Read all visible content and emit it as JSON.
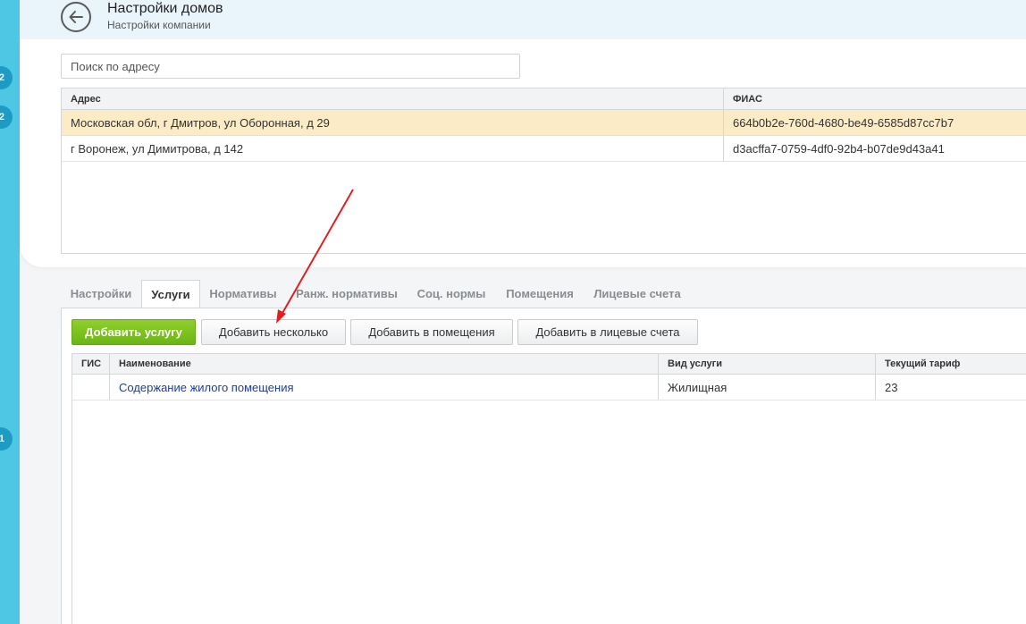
{
  "header": {
    "title": "Настройки домов",
    "subtitle": "Настройки компании"
  },
  "sidebar_badges": [
    "2",
    "2",
    "1"
  ],
  "search": {
    "placeholder": "Поиск по адресу",
    "value": ""
  },
  "houses": {
    "columns": [
      "Адрес",
      "ФИАС"
    ],
    "rows": [
      {
        "address": "Московская обл, г Дмитров, ул Оборонная, д 29",
        "fias": "664b0b2e-760d-4680-be49-6585d87cc7b7",
        "selected": true
      },
      {
        "address": "г Воронеж, ул Димитрова, д 142",
        "fias": "d3acffa7-0759-4df0-92b4-b07de9d43a41",
        "selected": false
      }
    ]
  },
  "tabs": [
    "Настройки",
    "Услуги",
    "Нормативы",
    "Ранж. нормативы",
    "Соц. нормы",
    "Помещения",
    "Лицевые счета"
  ],
  "active_tab": "Услуги",
  "buttons": {
    "add_service": "Добавить услугу",
    "add_several": "Добавить несколько",
    "add_to_rooms": "Добавить в помещения",
    "add_to_accounts": "Добавить в лицевые счета"
  },
  "services": {
    "columns": [
      "ГИС",
      "Наименование",
      "Вид услуги",
      "Текущий тариф"
    ],
    "rows": [
      {
        "gis": "",
        "name": "Содержание жилого помещения",
        "type": "Жилищная",
        "tariff": "23"
      }
    ]
  },
  "colors": {
    "sidebar": "#4ec7e4",
    "selected_row": "#fcebc7",
    "primary_button": "#7bc222",
    "link": "#1a3f9e",
    "annotation_arrow": "#e02020"
  }
}
